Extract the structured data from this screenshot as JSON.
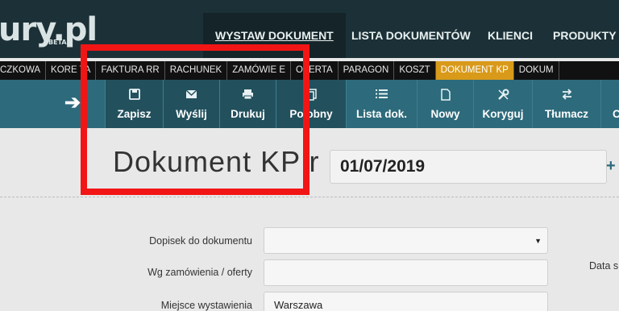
{
  "brand": {
    "logo_text": "ury.pl",
    "logo_badge": "BETA"
  },
  "top_nav": [
    {
      "label": "WYSTAW DOKUMENT",
      "active": true
    },
    {
      "label": "LISTA DOKUMENTÓW",
      "active": false
    },
    {
      "label": "KLIENCI",
      "active": false
    },
    {
      "label": "PRODUKTY",
      "active": false
    }
  ],
  "doc_types": [
    {
      "label": "CZKOWA",
      "active": false
    },
    {
      "label": "KORE TA",
      "active": false
    },
    {
      "label": "FAKTURA RR",
      "active": false
    },
    {
      "label": "RACHUNEK",
      "active": false
    },
    {
      "label": "ZAMÓWIE E",
      "active": false
    },
    {
      "label": "OFERTA",
      "active": false
    },
    {
      "label": "PARAGON",
      "active": false
    },
    {
      "label": "KOSZT",
      "active": false
    },
    {
      "label": "DOKUMENT KP",
      "active": true
    },
    {
      "label": "DOKUM",
      "active": false
    }
  ],
  "toolbar": {
    "buttons": [
      {
        "label": "Zapisz",
        "icon": "floppy-icon"
      },
      {
        "label": "Wyślij",
        "icon": "envelope-icon"
      },
      {
        "label": "Drukuj",
        "icon": "printer-icon"
      },
      {
        "label": "Po obny",
        "icon": "copy-icon"
      },
      {
        "label": "Lista dok.",
        "icon": "list-icon"
      },
      {
        "label": "Nowy",
        "icon": "new-document-icon"
      },
      {
        "label": "Koryguj",
        "icon": "wrench-icon"
      },
      {
        "label": "Tłumacz",
        "icon": "swap-icon"
      },
      {
        "label": "C",
        "icon": ""
      }
    ]
  },
  "document": {
    "title": "Dokument KP r r",
    "date_value": "01/07/2019"
  },
  "form": {
    "note_label": "Dopisek do dokumentu",
    "note_value": "",
    "order_label": "Wg zamówienia / oferty",
    "order_value": "",
    "place_label": "Miejsce wystawienia",
    "place_value": "Warszawa",
    "date_side_label": "Data s"
  },
  "colors": {
    "topbar": "#1c3137",
    "toolbar": "#2d6a7b",
    "active_doc_tab": "#d99a1a",
    "highlight": "#f21515"
  }
}
